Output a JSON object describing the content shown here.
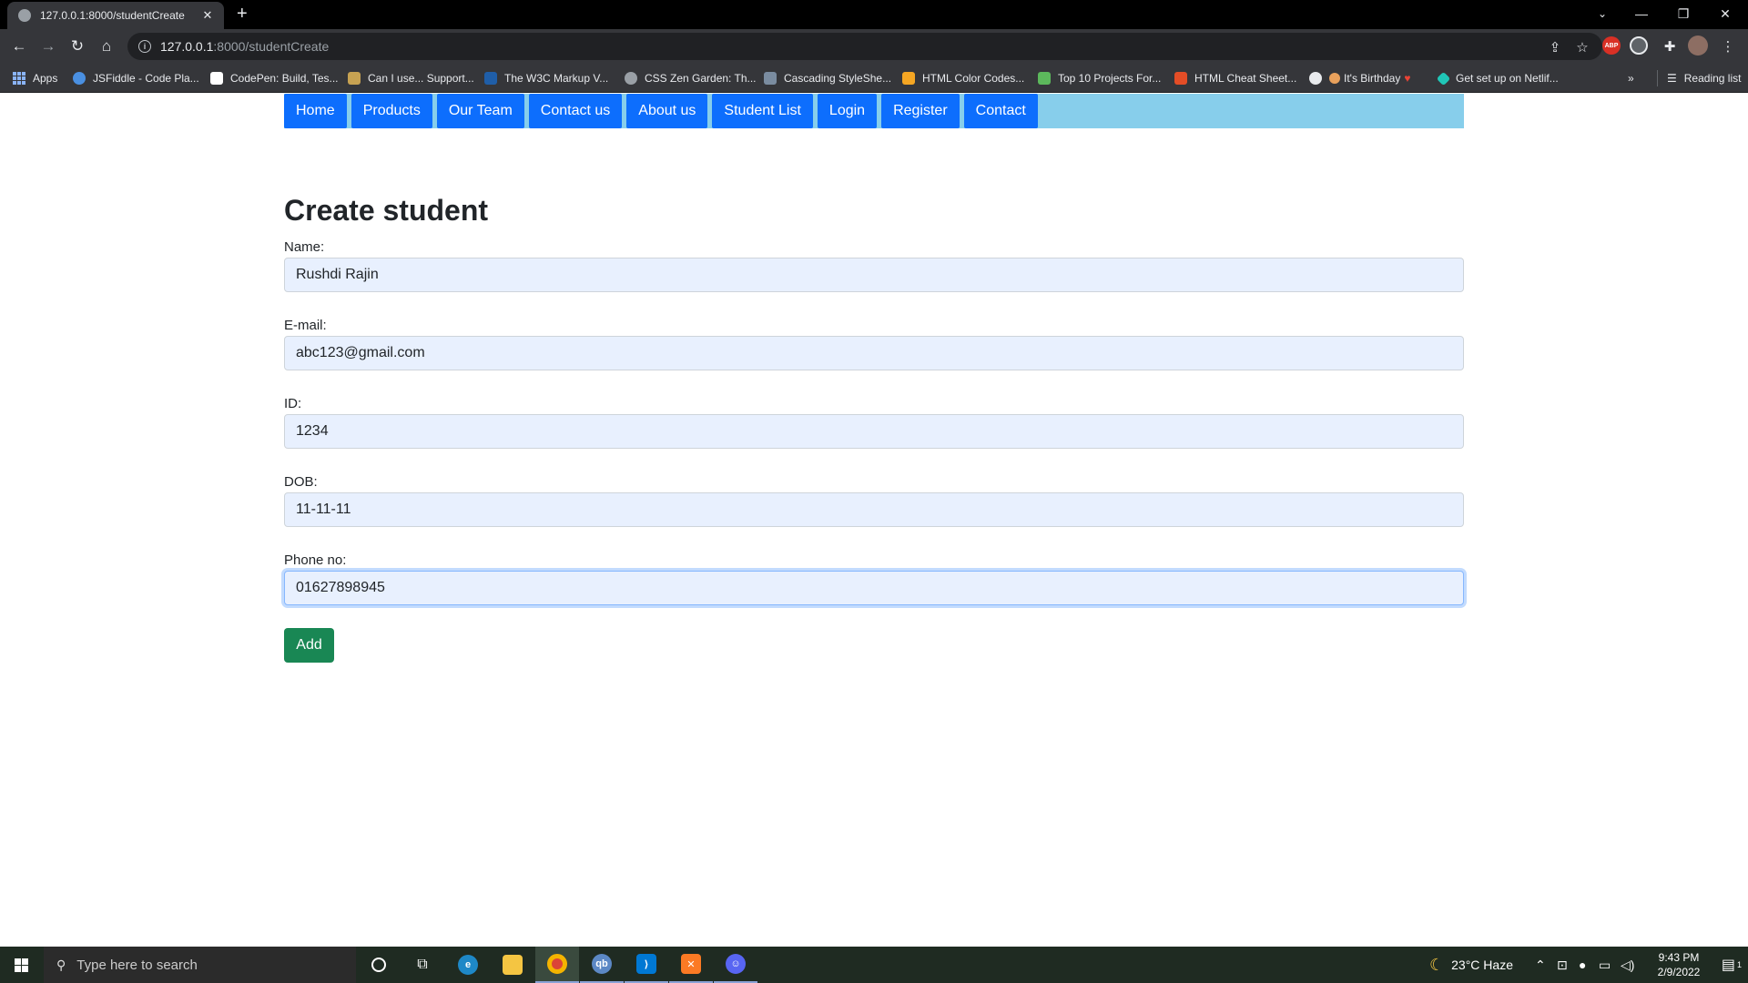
{
  "browser": {
    "tab_title": "127.0.0.1:8000/studentCreate",
    "url_host": "127.0.0.1",
    "url_path": ":8000/studentCreate",
    "extensions": [
      "ABP"
    ],
    "bookmarks": [
      {
        "label": "Apps",
        "color": "#8ab4f8"
      },
      {
        "label": "JSFiddle - Code Pla...",
        "color": "#4a90e2"
      },
      {
        "label": "CodePen: Build, Tes...",
        "color": "#ffffff"
      },
      {
        "label": "Can I use... Support...",
        "color": "#c7a252"
      },
      {
        "label": "The W3C Markup V...",
        "color": "#1f5ea8"
      },
      {
        "label": "CSS Zen Garden: Th...",
        "color": "#9aa0a6"
      },
      {
        "label": "Cascading StyleShe...",
        "color": "#7a8ca0"
      },
      {
        "label": "HTML Color Codes...",
        "color": "#f5a623"
      },
      {
        "label": "Top 10 Projects For...",
        "color": "#5cb85c"
      },
      {
        "label": "HTML Cheat Sheet...",
        "color": "#e44d26"
      },
      {
        "label": "It's Birthday",
        "color": "#e8a15c"
      },
      {
        "label": "Get set up on Netlif...",
        "color": "#20c6b7"
      }
    ],
    "reading_list": "Reading list"
  },
  "nav": {
    "links": [
      "Home",
      "Products",
      "Our Team",
      "Contact us",
      "About us",
      "Student List",
      "Login",
      "Register",
      "Contact"
    ],
    "bar_color": "#87ceeb",
    "link_color": "#0d6efd"
  },
  "form": {
    "title": "Create student",
    "fields": [
      {
        "label": "Name:",
        "value": "Rushdi Rajin"
      },
      {
        "label": "E-mail:",
        "value": "abc123@gmail.com"
      },
      {
        "label": "ID:",
        "value": "1234"
      },
      {
        "label": "DOB:",
        "value": "11-11-11"
      },
      {
        "label": "Phone no:",
        "value": "01627898945"
      }
    ],
    "submit_label": "Add",
    "submit_color": "#198754"
  },
  "taskbar": {
    "search_placeholder": "Type here to search",
    "weather": "23°C  Haze",
    "time": "9:43 PM",
    "date": "2/9/2022",
    "notification_count": "1"
  }
}
